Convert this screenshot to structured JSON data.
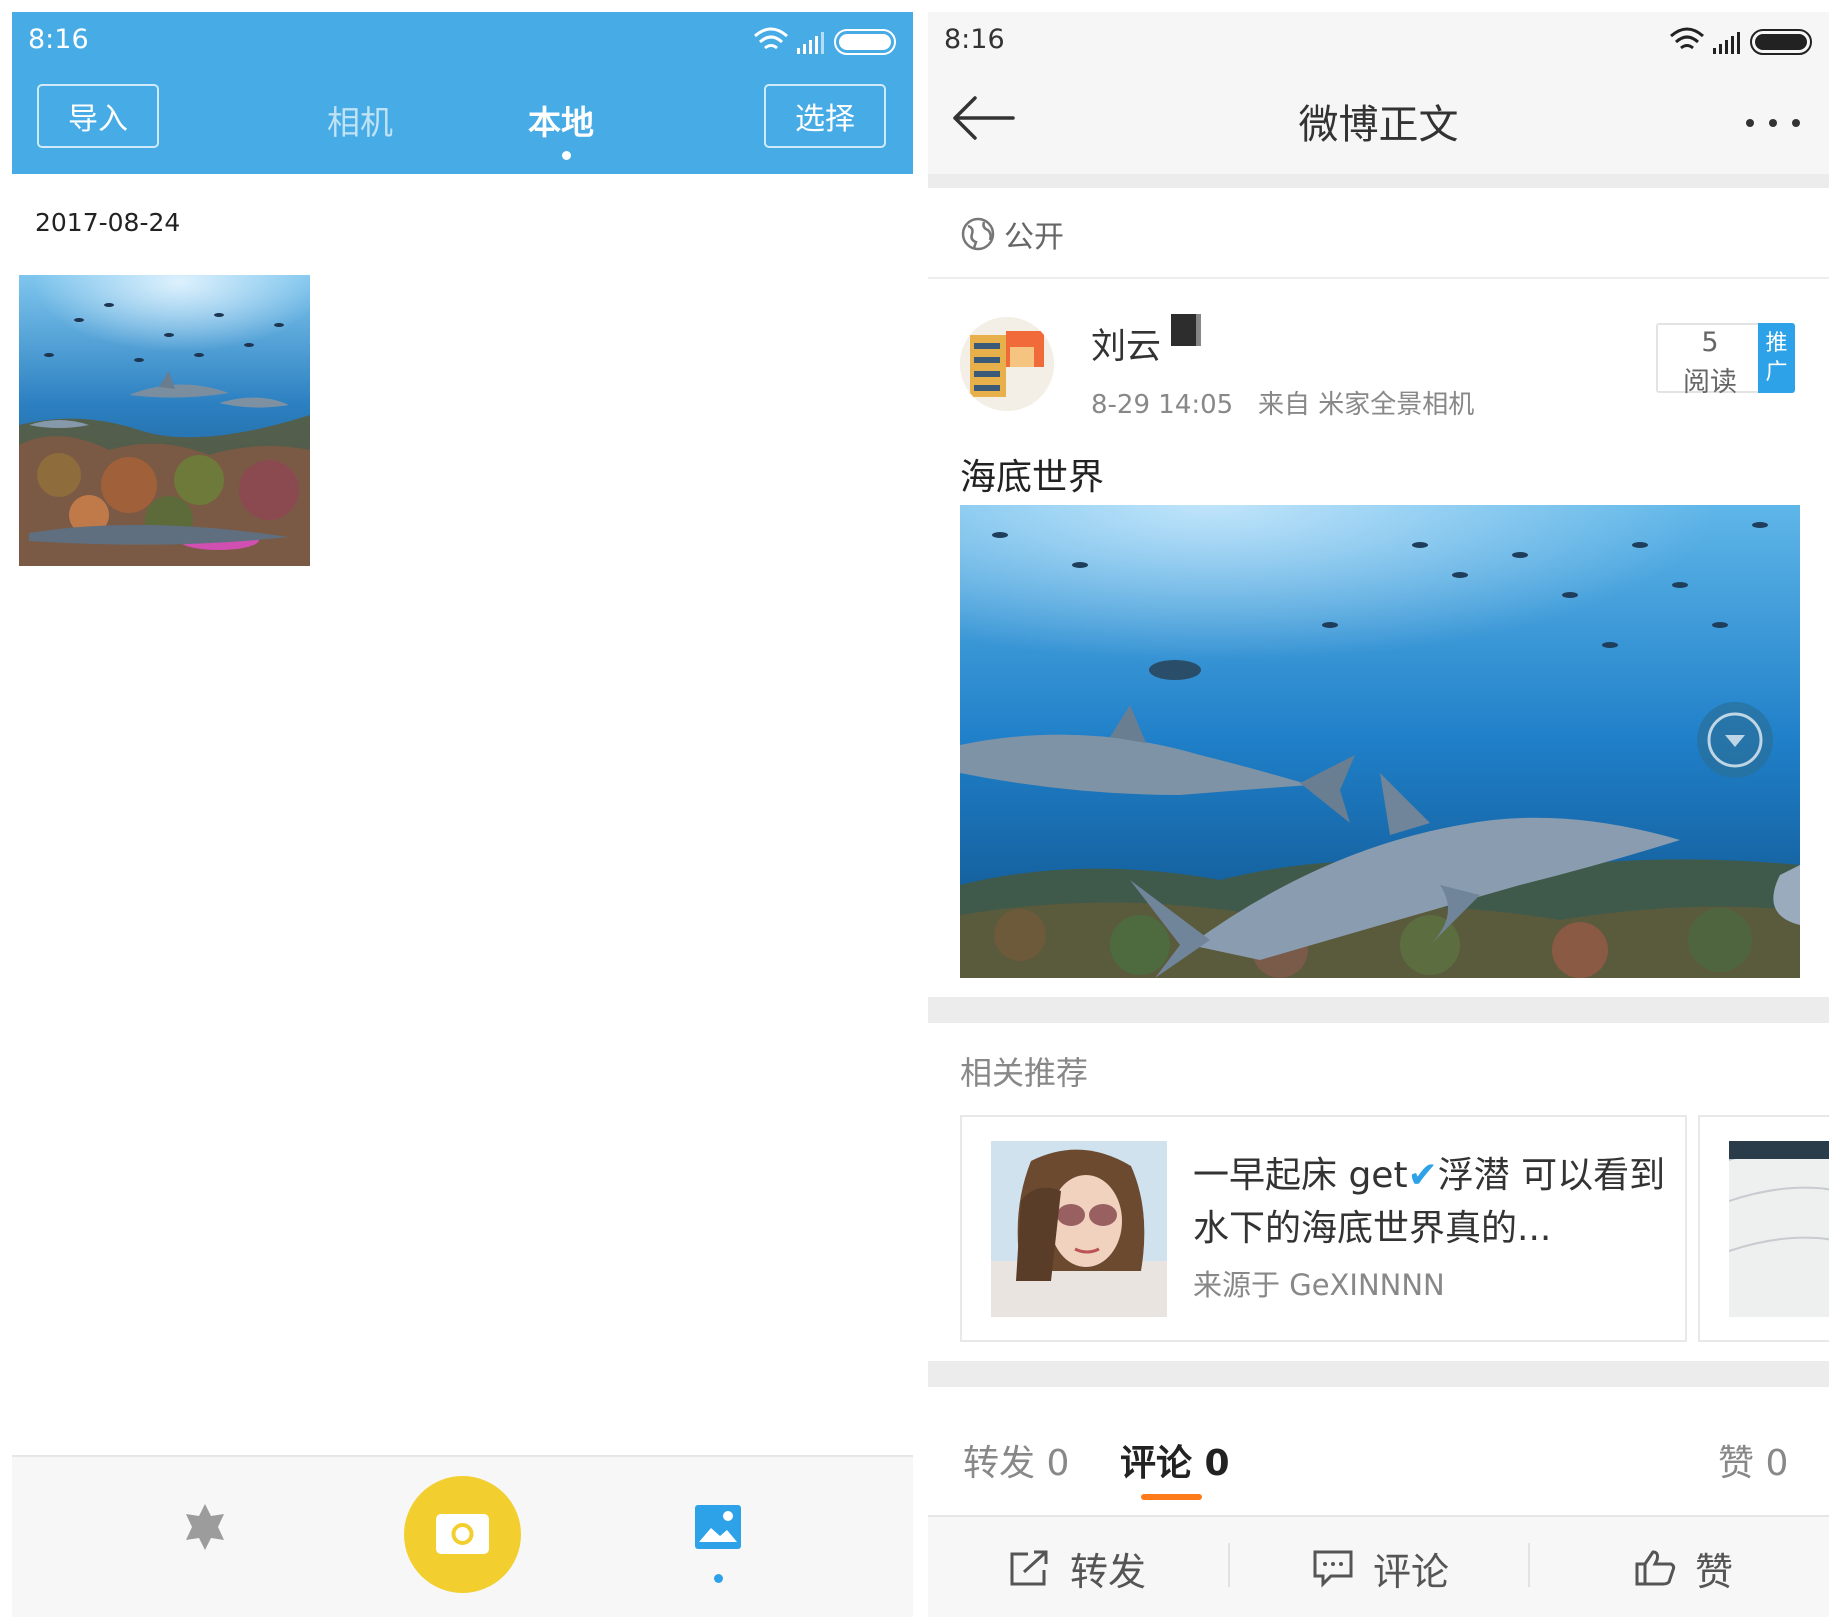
{
  "left": {
    "status_time": "8:16",
    "import_label": "导入",
    "tabs": [
      {
        "label": "相机",
        "active": false
      },
      {
        "label": "本地",
        "active": true
      }
    ],
    "select_label": "选择",
    "date_group": "2017-08-24",
    "accent": "#47abe6",
    "shoot_button_color": "#f2cf2e"
  },
  "right": {
    "status_time": "8:16",
    "title": "微博正文",
    "visibility": "公开",
    "username": "刘云",
    "post_time": "8-29 14:05",
    "source": "来自 米家全景相机",
    "read_count": "5",
    "read_label": "阅读",
    "promo_label_1": "推",
    "promo_label_2": "广",
    "post_text": "海底世界",
    "related_label": "相关推荐",
    "related_card": {
      "text_1": "一早起床 get",
      "text_2": "浮潜 可以看到水下的海底世界真的...",
      "source": "来源于 GeXINNNN"
    },
    "stats": {
      "repost": "转发 0",
      "comment": "评论 0",
      "like": "赞 0"
    },
    "actions": {
      "repost": "转发",
      "comment": "评论",
      "like": "赞"
    },
    "active_tab_color": "#ff7b1a"
  }
}
